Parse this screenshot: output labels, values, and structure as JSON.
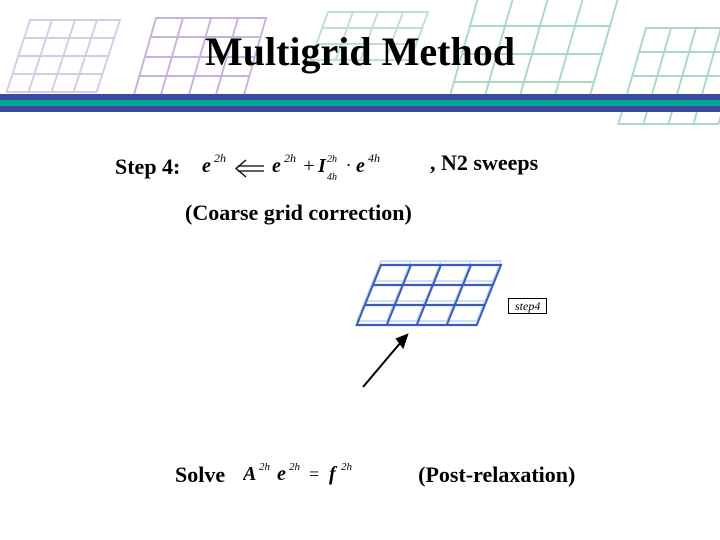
{
  "title": "Multigrid Method",
  "step_label": "Step 4:",
  "after_formula": ",  N2 sweeps",
  "subtitle": "(Coarse grid correction)",
  "diagram_step_label": "step4",
  "bottom": {
    "solve": "Solve",
    "post": "(Post-relaxation)"
  },
  "colors": {
    "bar_outer": "#3b4aa0",
    "bar_inner": "#00a88f",
    "grid_light": "#d8c9e6",
    "grid_light2": "#bde0d1",
    "grid_blue": "#3b5bbf",
    "arrow": "#000000"
  }
}
